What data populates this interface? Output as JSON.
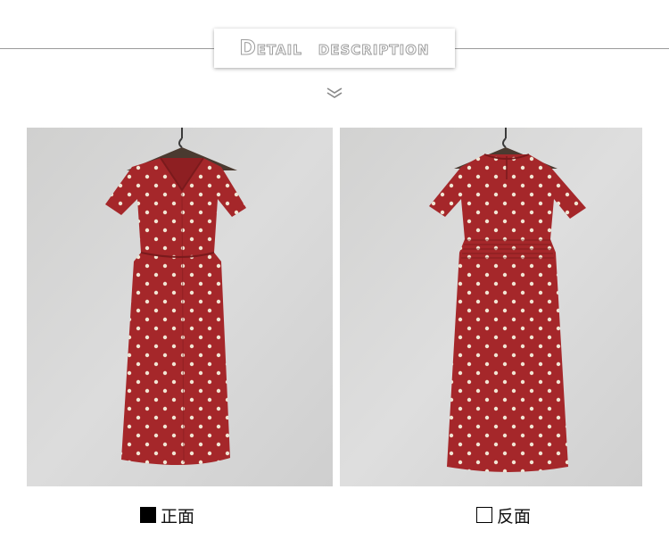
{
  "header": {
    "title_word1": "Detail",
    "title_word2": "description",
    "divider_color": "#9a9a9a",
    "chevron_icon": "double-chevron-down-icon"
  },
  "photos": [
    {
      "view": "front",
      "caption": "正面",
      "marker": "filled-square",
      "dress_color": "#a8282a",
      "dot_color": "#f1e6d4"
    },
    {
      "view": "back",
      "caption": "反面",
      "marker": "empty-square",
      "dress_color": "#a8282a",
      "dot_color": "#f1e6d4"
    }
  ]
}
